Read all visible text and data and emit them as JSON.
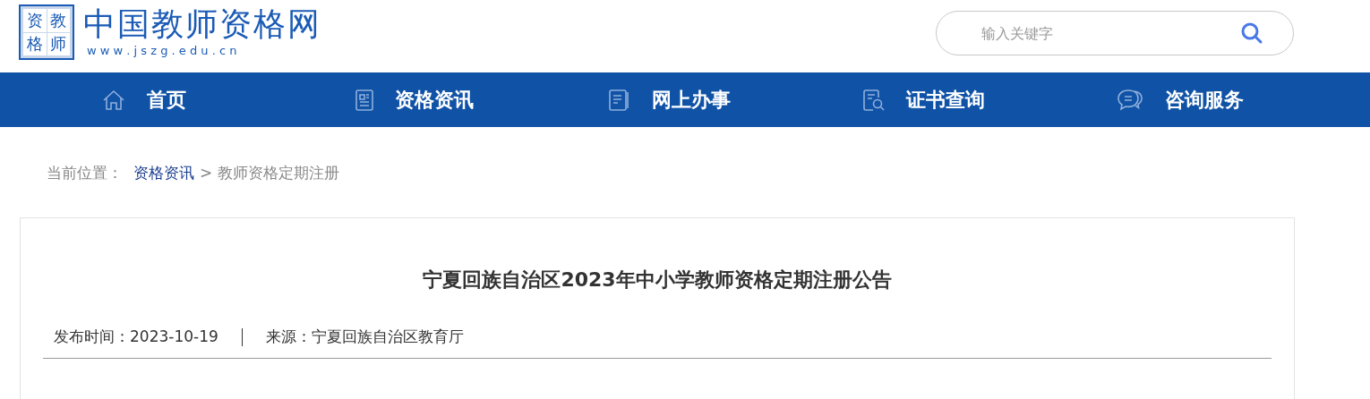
{
  "logo": {
    "badge_chars": [
      "资",
      "教",
      "格",
      "师"
    ],
    "title": "中国教师资格网",
    "url": "w w w . j s z g . e d u . c n"
  },
  "search": {
    "placeholder": "输入关键字"
  },
  "nav": [
    {
      "label": "首页",
      "kind": "home"
    },
    {
      "label": "资格资讯",
      "kind": "news"
    },
    {
      "label": "网上办事",
      "kind": "doc"
    },
    {
      "label": "证书查询",
      "kind": "query"
    },
    {
      "label": "咨询服务",
      "kind": "chat"
    }
  ],
  "breadcrumb": {
    "prefix": "当前位置：",
    "link": "资格资讯",
    "separator": ">",
    "current": "教师资格定期注册"
  },
  "article": {
    "title": "宁夏回族自治区2023年中小学教师资格定期注册公告",
    "date_label": "发布时间：",
    "date": "2023-10-19",
    "source_label": "来源：",
    "source": "宁夏回族自治区教育厅"
  }
}
